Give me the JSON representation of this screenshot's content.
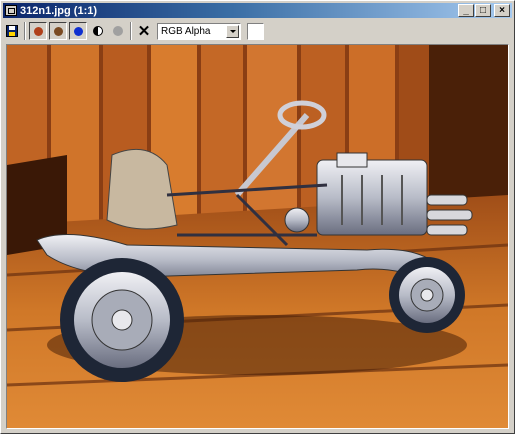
{
  "window": {
    "title": "312n1.jpg (1:1)",
    "controls": {
      "minimize": "_",
      "restore": "□",
      "close": "×"
    }
  },
  "toolbar": {
    "channel_select": {
      "value": "RGB Alpha"
    },
    "icons": [
      "save-icon",
      "red-channel-icon",
      "green-channel-icon",
      "blue-channel-icon",
      "mono-display-icon",
      "alpha-channel-icon",
      "clear-icon"
    ]
  },
  "image": {
    "subject": "vintage-car-model-on-wood-planks",
    "colors": {
      "wood_dark": "#5a2810",
      "wood_mid": "#b55a1c",
      "wood_light": "#e89240",
      "metal": "#d8d8dc",
      "tire": "#202838"
    }
  }
}
